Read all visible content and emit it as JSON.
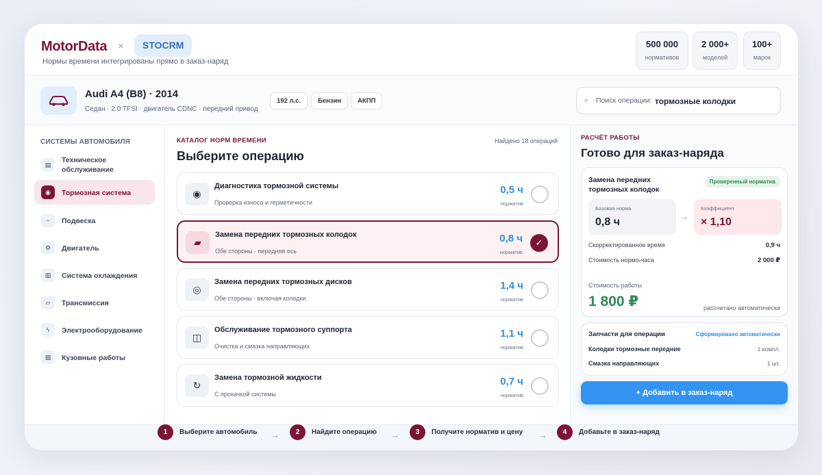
{
  "header": {
    "brand": "MotorData",
    "separator": "×",
    "partner": "STOCRM",
    "tagline": "Нормы времени интегрированы прямо в заказ-наряд",
    "stats": [
      {
        "value": "500 000",
        "label": "нормативов"
      },
      {
        "value": "2 000+",
        "label": "моделей"
      },
      {
        "value": "100+",
        "label": "марок"
      }
    ]
  },
  "car": {
    "icon": "car-icon",
    "title": "Audi A4 (B8) · 2014",
    "subtitle": "Седан · 2.0 TFSI · двигатель CDNC · передний привод",
    "chips": [
      "192 л.с.",
      "Бензин",
      "АКПП"
    ]
  },
  "search": {
    "icon": "search-icon",
    "label": "Поиск операции:",
    "value": "тормозные колодки"
  },
  "sidebar": {
    "title": "СИСТЕМЫ АВТОМОБИЛЯ",
    "items": [
      {
        "label": "Техническое обслуживание",
        "glyph": "▤",
        "icon": "maintenance-icon",
        "active": false
      },
      {
        "label": "Тормозная система",
        "glyph": "◉",
        "icon": "brake-icon",
        "active": true
      },
      {
        "label": "Подвеска",
        "glyph": "~",
        "icon": "suspension-icon",
        "active": false
      },
      {
        "label": "Двигатель",
        "glyph": "⚙",
        "icon": "engine-icon",
        "active": false
      },
      {
        "label": "Система охлаждения",
        "glyph": "▥",
        "icon": "cooling-icon",
        "active": false
      },
      {
        "label": "Трансмиссия",
        "glyph": "▱",
        "icon": "transmission-icon",
        "active": false
      },
      {
        "label": "Электрооборудование",
        "glyph": "ϟ",
        "icon": "electrical-icon",
        "active": false
      },
      {
        "label": "Кузовные работы",
        "glyph": "▧",
        "icon": "body-icon",
        "active": false
      }
    ]
  },
  "catalog": {
    "eyebrow": "КАТАЛОГ НОРМ ВРЕМЕНИ",
    "found": "Найдено 18 операций",
    "title": "Выберите операцию",
    "value_label": "норматив",
    "operations": [
      {
        "title": "Диагностика тормозной системы",
        "subtitle": "Проверка износа и герметичности",
        "value": "0,5 ч",
        "glyph": "◉",
        "icon": "diagnostics-icon",
        "selected": false
      },
      {
        "title": "Замена передних тормозных колодок",
        "subtitle": "Обе стороны · передняя ось",
        "value": "0,8 ч",
        "glyph": "▰",
        "icon": "brake-pad-icon",
        "selected": true
      },
      {
        "title": "Замена передних тормозных дисков",
        "subtitle": "Обе стороны · включая колодки",
        "value": "1,4 ч",
        "glyph": "◎",
        "icon": "brake-disc-icon",
        "selected": false
      },
      {
        "title": "Обслуживание тормозного суппорта",
        "subtitle": "Очистка и смазка направляющих",
        "value": "1,1 ч",
        "glyph": "◫",
        "icon": "caliper-icon",
        "selected": false
      },
      {
        "title": "Замена тормозной жидкости",
        "subtitle": "С прокачкой системы",
        "value": "0,7 ч",
        "glyph": "↻",
        "icon": "fluid-icon",
        "selected": false
      }
    ],
    "check_glyph": "✓"
  },
  "calc": {
    "eyebrow": "РАСЧЁТ РАБОТЫ",
    "title": "Готово для заказ-наряда",
    "operation": "Замена передних тормозных колодок",
    "badge": "Проверенный норматив",
    "base_label": "Базовая норма",
    "base_value": "0,8 ч",
    "arrow": "→",
    "coef_label": "Коэффициент",
    "coef_value": "× 1,10",
    "adjusted_label": "Скорректированное время",
    "adjusted_value": "0,9 ч",
    "rate_label": "Стоимость нормо-часа",
    "rate_value": "2 000 ₽",
    "cost_label": "Стоимость работы",
    "cost_value": "1 800 ₽",
    "cost_note": "рассчитано автоматически"
  },
  "parts": {
    "title": "Запчасти для операции",
    "auto": "Сформировано автоматически",
    "items": [
      {
        "name": "Колодки тормозные передние",
        "qty": "1 компл."
      },
      {
        "name": "Смазка направляющих",
        "qty": "1 шт."
      }
    ]
  },
  "add_button": "+ Добавить в заказ-наряд",
  "steps": [
    {
      "num": "1",
      "label": "Выберите автомобиль"
    },
    {
      "num": "2",
      "label": "Найдите операцию"
    },
    {
      "num": "3",
      "label": "Получите норматив и цену"
    },
    {
      "num": "4",
      "label": "Добавьте в заказ-наряд"
    }
  ],
  "step_arrow": "→",
  "colors": {
    "brand": "#7a1535",
    "accent": "#3294f0",
    "value_blue": "#2f8ee0",
    "success": "#2e8a55"
  }
}
